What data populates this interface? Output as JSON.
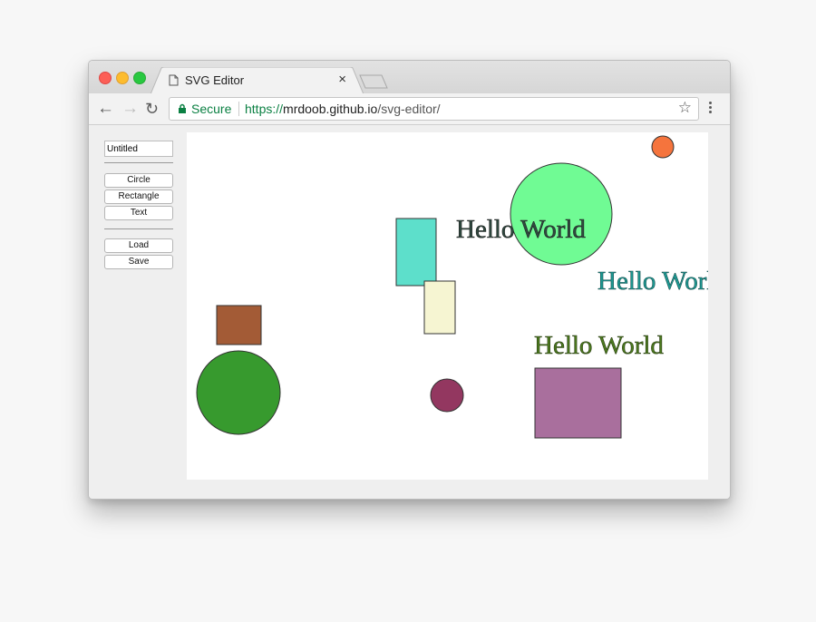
{
  "browser": {
    "tab_title": "SVG Editor",
    "tab_close": "×",
    "secure_label": "Secure",
    "url_scheme": "https://",
    "url_host": "mrdoob.github.io",
    "url_path": "/svg-editor/",
    "bookmark_star": "☆",
    "back": "←",
    "forward": "→",
    "reload": "↻"
  },
  "sidebar": {
    "title_value": "Untitled",
    "buttons": {
      "circle": "Circle",
      "rectangle": "Rectangle",
      "text": "Text",
      "load": "Load",
      "save": "Save"
    }
  },
  "canvas": {
    "texts": {
      "t1": "Hello World",
      "t2": "Hello Worl",
      "t3": "Hello World"
    },
    "colors": {
      "orange_circle": "#f5743d",
      "green_circle_large": "#70fb94",
      "teal_rect": "#5ddfcb",
      "cream_rect": "#f6f5d2",
      "brown_rect": "#a35b36",
      "dark_green_circle": "#379a2e",
      "maroon_circle": "#933760",
      "purple_rect": "#a96f9d",
      "text_dark": "#2f4a40",
      "text_teal": "#1e9a94",
      "text_olive": "#4c7a1e"
    }
  }
}
